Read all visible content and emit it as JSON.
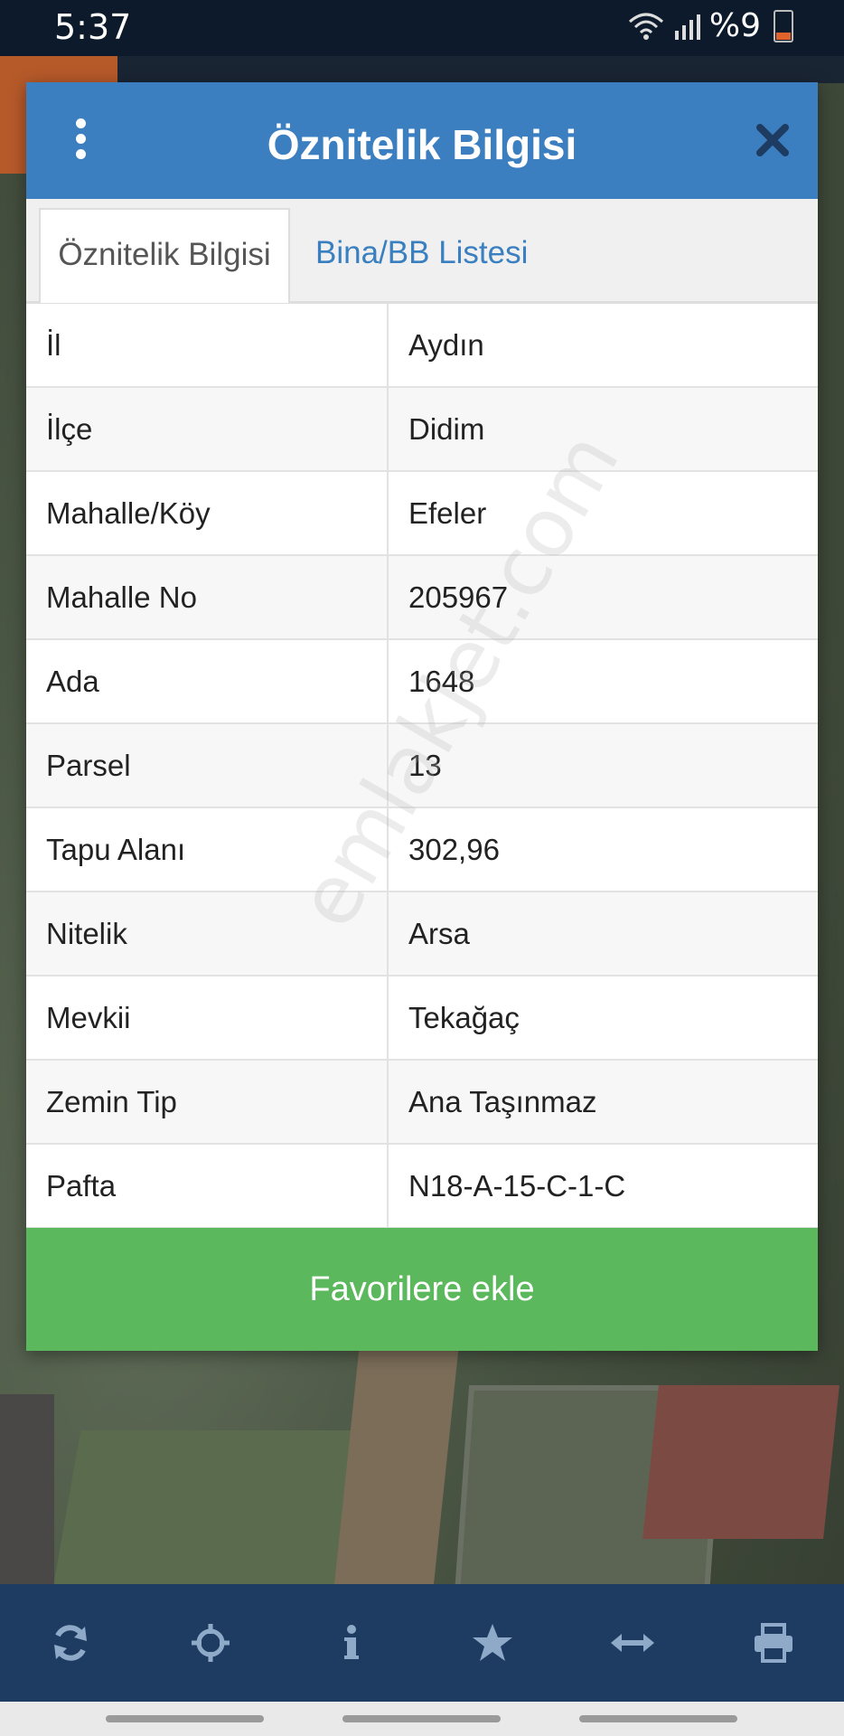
{
  "status_bar": {
    "time": "5:37",
    "battery": "%9"
  },
  "dialog": {
    "title": "Öznitelik Bilgisi",
    "tabs": [
      {
        "label": "Öznitelik Bilgisi",
        "active": true
      },
      {
        "label": "Bina/BB Listesi",
        "active": false
      }
    ],
    "rows": [
      {
        "key": "İl",
        "value": "Aydın"
      },
      {
        "key": "İlçe",
        "value": "Didim"
      },
      {
        "key": "Mahalle/Köy",
        "value": "Efeler"
      },
      {
        "key": "Mahalle No",
        "value": "205967"
      },
      {
        "key": "Ada",
        "value": "1648"
      },
      {
        "key": "Parsel",
        "value": "13"
      },
      {
        "key": "Tapu Alanı",
        "value": "302,96"
      },
      {
        "key": "Nitelik",
        "value": "Arsa"
      },
      {
        "key": "Mevkii",
        "value": "Tekağaç"
      },
      {
        "key": "Zemin Tip",
        "value": "Ana Taşınmaz"
      },
      {
        "key": "Pafta",
        "value": "N18-A-15-C-1-C"
      }
    ],
    "favorite_button": "Favorilere ekle",
    "watermark": "emlakjet.com"
  },
  "toolbar": {
    "icons": [
      "refresh-icon",
      "crosshair-icon",
      "info-icon",
      "star-icon",
      "measure-icon",
      "print-icon"
    ],
    "icon_color": "#8eaac8"
  },
  "colors": {
    "header": "#3b7fc0",
    "favorite": "#5cb85c",
    "toolbar": "#1e3c62"
  }
}
